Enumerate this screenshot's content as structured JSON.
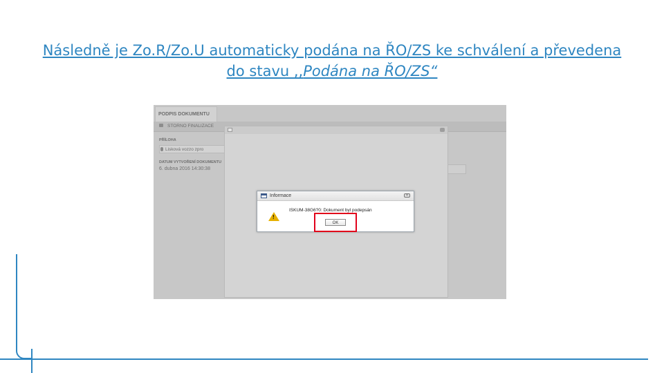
{
  "slide": {
    "title_part1": "Následně je Zo.R/Zo.U automaticky podána na ŘO/ZS ke schválení a převedena do stavu ,,",
    "title_em": "Podána na ŘO/ZS“"
  },
  "screenshot": {
    "tab_label": "PODPIS DOKUMENTU",
    "toolbar_storno": "STORNO FINALIZACE",
    "field1_label": "PŘÍLOHA",
    "field1_value": "Lisková vozzo zpro",
    "field2_label": "DATUM VYTVOŘENÍ DOKUMENTU",
    "field2_value": "6. dubna 2016 14:30:38",
    "dialog": {
      "title": "Informace",
      "message": "ISKUM-38G6?0: Dokument byl podepsán",
      "ok_label": "OK",
      "close_icon": "close-icon",
      "warning_icon": "warning-icon"
    },
    "colors": {
      "highlight": "#e1001a",
      "title": "#2e86c1"
    }
  }
}
